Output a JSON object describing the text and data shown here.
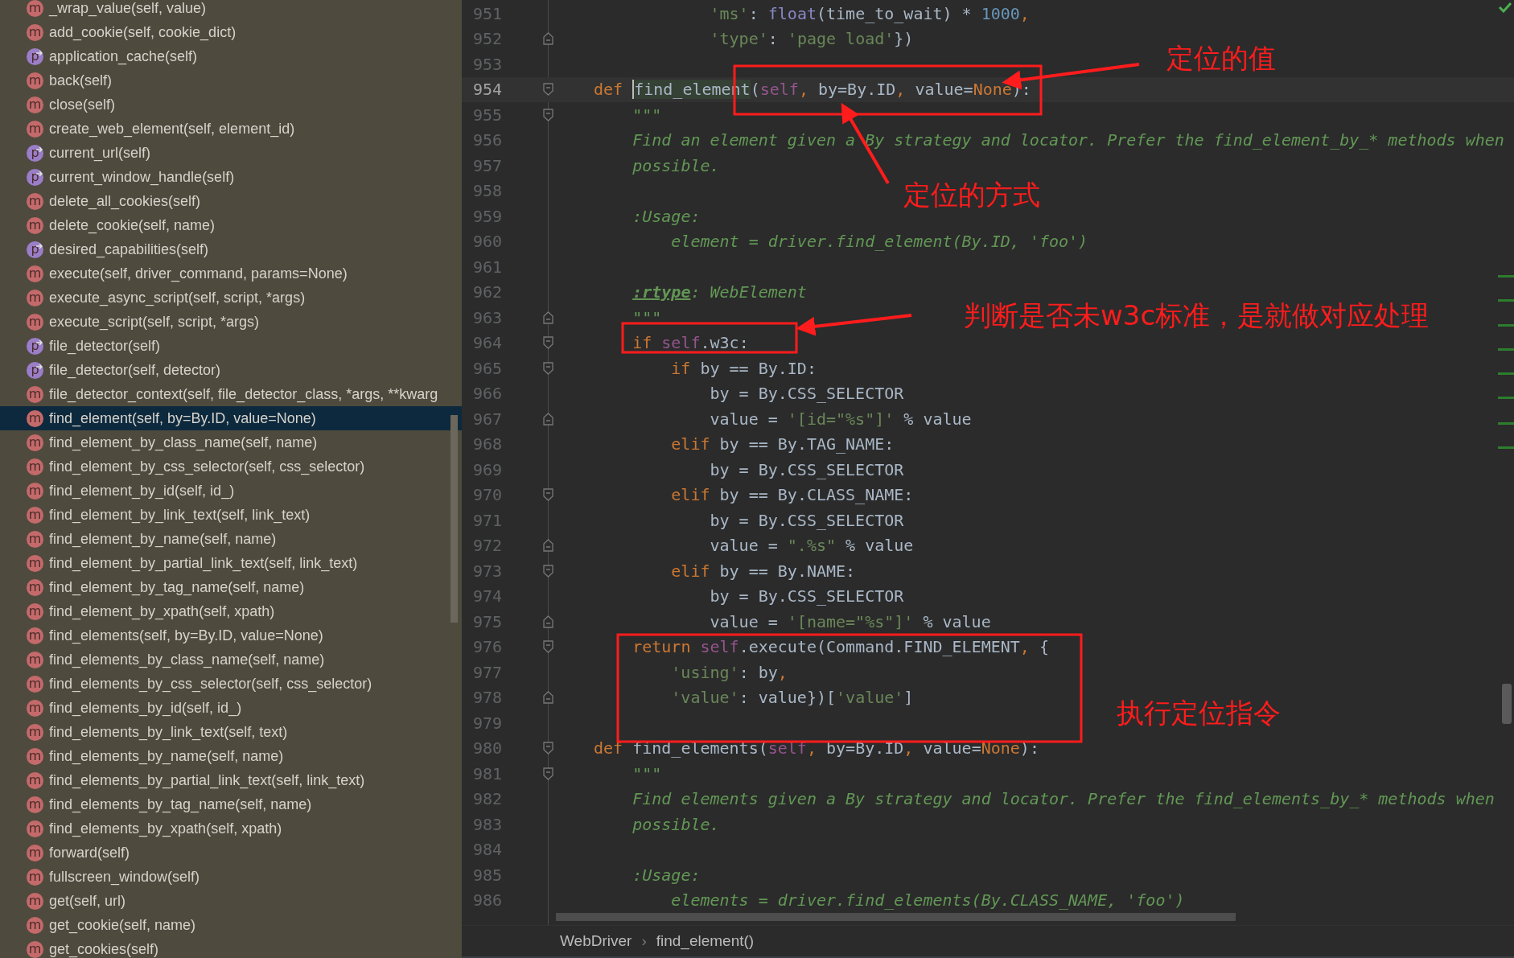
{
  "structure": {
    "items": [
      {
        "kind": "method",
        "badge": "m",
        "label": "_wrap_value(self, value)",
        "selected": false
      },
      {
        "kind": "method",
        "badge": "m",
        "label": "add_cookie(self, cookie_dict)",
        "selected": false
      },
      {
        "kind": "property",
        "badge": "p",
        "label": "application_cache(self)",
        "selected": false
      },
      {
        "kind": "method",
        "badge": "m",
        "label": "back(self)",
        "selected": false
      },
      {
        "kind": "method",
        "badge": "m",
        "label": "close(self)",
        "selected": false
      },
      {
        "kind": "method",
        "badge": "m",
        "label": "create_web_element(self, element_id)",
        "selected": false
      },
      {
        "kind": "property",
        "badge": "p",
        "label": "current_url(self)",
        "selected": false
      },
      {
        "kind": "property",
        "badge": "p",
        "label": "current_window_handle(self)",
        "selected": false
      },
      {
        "kind": "method",
        "badge": "m",
        "label": "delete_all_cookies(self)",
        "selected": false
      },
      {
        "kind": "method",
        "badge": "m",
        "label": "delete_cookie(self, name)",
        "selected": false
      },
      {
        "kind": "property",
        "badge": "p",
        "label": "desired_capabilities(self)",
        "selected": false
      },
      {
        "kind": "method",
        "badge": "m",
        "label": "execute(self, driver_command, params=None)",
        "selected": false
      },
      {
        "kind": "method",
        "badge": "m",
        "label": "execute_async_script(self, script, *args)",
        "selected": false
      },
      {
        "kind": "method",
        "badge": "m",
        "label": "execute_script(self, script, *args)",
        "selected": false
      },
      {
        "kind": "property",
        "badge": "p",
        "label": "file_detector(self)",
        "selected": false
      },
      {
        "kind": "property",
        "badge": "p",
        "label": "file_detector(self, detector)",
        "selected": false
      },
      {
        "kind": "method",
        "badge": "m",
        "label": "file_detector_context(self, file_detector_class, *args, **kwarg",
        "selected": false
      },
      {
        "kind": "method",
        "badge": "m",
        "label": "find_element(self, by=By.ID, value=None)",
        "selected": true
      },
      {
        "kind": "method",
        "badge": "m",
        "label": "find_element_by_class_name(self, name)",
        "selected": false
      },
      {
        "kind": "method",
        "badge": "m",
        "label": "find_element_by_css_selector(self, css_selector)",
        "selected": false
      },
      {
        "kind": "method",
        "badge": "m",
        "label": "find_element_by_id(self, id_)",
        "selected": false
      },
      {
        "kind": "method",
        "badge": "m",
        "label": "find_element_by_link_text(self, link_text)",
        "selected": false
      },
      {
        "kind": "method",
        "badge": "m",
        "label": "find_element_by_name(self, name)",
        "selected": false
      },
      {
        "kind": "method",
        "badge": "m",
        "label": "find_element_by_partial_link_text(self, link_text)",
        "selected": false
      },
      {
        "kind": "method",
        "badge": "m",
        "label": "find_element_by_tag_name(self, name)",
        "selected": false
      },
      {
        "kind": "method",
        "badge": "m",
        "label": "find_element_by_xpath(self, xpath)",
        "selected": false
      },
      {
        "kind": "method",
        "badge": "m",
        "label": "find_elements(self, by=By.ID, value=None)",
        "selected": false
      },
      {
        "kind": "method",
        "badge": "m",
        "label": "find_elements_by_class_name(self, name)",
        "selected": false
      },
      {
        "kind": "method",
        "badge": "m",
        "label": "find_elements_by_css_selector(self, css_selector)",
        "selected": false
      },
      {
        "kind": "method",
        "badge": "m",
        "label": "find_elements_by_id(self, id_)",
        "selected": false
      },
      {
        "kind": "method",
        "badge": "m",
        "label": "find_elements_by_link_text(self, text)",
        "selected": false
      },
      {
        "kind": "method",
        "badge": "m",
        "label": "find_elements_by_name(self, name)",
        "selected": false
      },
      {
        "kind": "method",
        "badge": "m",
        "label": "find_elements_by_partial_link_text(self, link_text)",
        "selected": false
      },
      {
        "kind": "method",
        "badge": "m",
        "label": "find_elements_by_tag_name(self, name)",
        "selected": false
      },
      {
        "kind": "method",
        "badge": "m",
        "label": "find_elements_by_xpath(self, xpath)",
        "selected": false
      },
      {
        "kind": "method",
        "badge": "m",
        "label": "forward(self)",
        "selected": false
      },
      {
        "kind": "method",
        "badge": "m",
        "label": "fullscreen_window(self)",
        "selected": false
      },
      {
        "kind": "method",
        "badge": "m",
        "label": "get(self, url)",
        "selected": false
      },
      {
        "kind": "method",
        "badge": "m",
        "label": "get_cookie(self, name)",
        "selected": false
      },
      {
        "kind": "method",
        "badge": "m",
        "label": "get_cookies(self)",
        "selected": false
      }
    ]
  },
  "editor": {
    "lines": [
      {
        "number": "951",
        "current": false,
        "tokens": [
          {
            "kind": "str",
            "text": "            'ms'"
          },
          {
            "kind": "p",
            "text": ": "
          },
          {
            "kind": "bi",
            "text": "float"
          },
          {
            "kind": "p",
            "text": "(time_to_wait) * "
          },
          {
            "kind": "num",
            "text": "1000"
          },
          {
            "kind": "kw",
            "text": ","
          }
        ]
      },
      {
        "number": "952",
        "current": false,
        "fold": {
          "kind": "close"
        },
        "tokens": [
          {
            "kind": "str",
            "text": "            'type'"
          },
          {
            "kind": "p",
            "text": ": "
          },
          {
            "kind": "str",
            "text": "'page load'"
          },
          {
            "kind": "p",
            "text": "})"
          }
        ]
      },
      {
        "number": "953",
        "current": false
      },
      {
        "number": "954",
        "current": true,
        "fold": {
          "kind": "open"
        },
        "tokens": [
          {
            "kind": "kw",
            "text": "def "
          },
          {
            "kind": "hl",
            "text": "find_element"
          },
          {
            "kind": "p",
            "text": "("
          },
          {
            "kind": "self",
            "text": "self"
          },
          {
            "kind": "kw",
            "text": ", "
          },
          {
            "kind": "p",
            "text": "by=By.ID"
          },
          {
            "kind": "kw",
            "text": ", "
          },
          {
            "kind": "p",
            "text": "value="
          },
          {
            "kind": "kw",
            "text": "None"
          },
          {
            "kind": "p",
            "text": "):"
          }
        ]
      },
      {
        "number": "955",
        "current": false,
        "fold": {
          "kind": "open"
        },
        "tokens": [
          {
            "kind": "doc",
            "text": "    \"\"\""
          }
        ]
      },
      {
        "number": "956",
        "current": false,
        "tokens": [
          {
            "kind": "doc",
            "text": "    Find an element given a By strategy and locator. Prefer the find_element_by_* methods when"
          }
        ]
      },
      {
        "number": "957",
        "current": false,
        "tokens": [
          {
            "kind": "doc",
            "text": "    possible."
          }
        ]
      },
      {
        "number": "958",
        "current": false
      },
      {
        "number": "959",
        "current": false,
        "tokens": [
          {
            "kind": "doc",
            "text": "    :Usage:"
          }
        ]
      },
      {
        "number": "960",
        "current": false,
        "tokens": [
          {
            "kind": "doc",
            "text": "        element = driver.find_element(By.ID, 'foo')"
          }
        ]
      },
      {
        "number": "961",
        "current": false
      },
      {
        "number": "962",
        "current": false,
        "tokens": [
          {
            "kind": "tag",
            "text": "    :rtype"
          },
          {
            "kind": "doc",
            "text": ": WebElement"
          }
        ]
      },
      {
        "number": "963",
        "current": false,
        "fold": {
          "kind": "close"
        },
        "tokens": [
          {
            "kind": "doc",
            "text": "    \"\"\""
          }
        ]
      },
      {
        "number": "964",
        "current": false,
        "fold": {
          "kind": "open"
        },
        "tokens": [
          {
            "kind": "kw",
            "text": "    if "
          },
          {
            "kind": "self",
            "text": "self"
          },
          {
            "kind": "p",
            "text": ".w3c:"
          }
        ]
      },
      {
        "number": "965",
        "current": false,
        "fold": {
          "kind": "open"
        },
        "tokens": [
          {
            "kind": "kw",
            "text": "        if "
          },
          {
            "kind": "p",
            "text": "by == By.ID:"
          }
        ]
      },
      {
        "number": "966",
        "current": false,
        "tokens": [
          {
            "kind": "p",
            "text": "            by = By.CSS_SELECTOR"
          }
        ]
      },
      {
        "number": "967",
        "current": false,
        "fold": {
          "kind": "close"
        },
        "tokens": [
          {
            "kind": "p",
            "text": "            value = "
          },
          {
            "kind": "str",
            "text": "'[id=\"%s\"]'"
          },
          {
            "kind": "p",
            "text": " % value"
          }
        ]
      },
      {
        "number": "968",
        "current": false,
        "tokens": [
          {
            "kind": "kw",
            "text": "        elif "
          },
          {
            "kind": "p",
            "text": "by == By.TAG_NAME:"
          }
        ]
      },
      {
        "number": "969",
        "current": false,
        "tokens": [
          {
            "kind": "p",
            "text": "            by = By.CSS_SELECTOR"
          }
        ]
      },
      {
        "number": "970",
        "current": false,
        "fold": {
          "kind": "open"
        },
        "tokens": [
          {
            "kind": "kw",
            "text": "        elif "
          },
          {
            "kind": "p",
            "text": "by == By.CLASS_NAME:"
          }
        ]
      },
      {
        "number": "971",
        "current": false,
        "tokens": [
          {
            "kind": "p",
            "text": "            by = By.CSS_SELECTOR"
          }
        ]
      },
      {
        "number": "972",
        "current": false,
        "fold": {
          "kind": "close"
        },
        "tokens": [
          {
            "kind": "p",
            "text": "            value = "
          },
          {
            "kind": "str",
            "text": "\".%s\""
          },
          {
            "kind": "p",
            "text": " % value"
          }
        ]
      },
      {
        "number": "973",
        "current": false,
        "fold": {
          "kind": "open"
        },
        "tokens": [
          {
            "kind": "kw",
            "text": "        elif "
          },
          {
            "kind": "p",
            "text": "by == By.NAME:"
          }
        ]
      },
      {
        "number": "974",
        "current": false,
        "tokens": [
          {
            "kind": "p",
            "text": "            by = By.CSS_SELECTOR"
          }
        ]
      },
      {
        "number": "975",
        "current": false,
        "fold": {
          "kind": "close"
        },
        "tokens": [
          {
            "kind": "p",
            "text": "            value = "
          },
          {
            "kind": "str",
            "text": "'[name=\"%s\"]'"
          },
          {
            "kind": "p",
            "text": " % value"
          }
        ]
      },
      {
        "number": "976",
        "current": false,
        "fold": {
          "kind": "open"
        },
        "tokens": [
          {
            "kind": "kw",
            "text": "    return "
          },
          {
            "kind": "self",
            "text": "self"
          },
          {
            "kind": "p",
            "text": ".execute(Command.FIND_ELEMENT"
          },
          {
            "kind": "kw",
            "text": ", "
          },
          {
            "kind": "p",
            "text": "{"
          }
        ]
      },
      {
        "number": "977",
        "current": false,
        "tokens": [
          {
            "kind": "str",
            "text": "        'using'"
          },
          {
            "kind": "p",
            "text": ": by"
          },
          {
            "kind": "kw",
            "text": ","
          }
        ]
      },
      {
        "number": "978",
        "current": false,
        "fold": {
          "kind": "close"
        },
        "tokens": [
          {
            "kind": "str",
            "text": "        'value'"
          },
          {
            "kind": "p",
            "text": ": value})["
          },
          {
            "kind": "str",
            "text": "'value'"
          },
          {
            "kind": "p",
            "text": "]"
          }
        ]
      },
      {
        "number": "979",
        "current": false
      },
      {
        "number": "980",
        "current": false,
        "fold": {
          "kind": "open"
        },
        "tokens": [
          {
            "kind": "kw",
            "text": "def "
          },
          {
            "kind": "p",
            "text": "find_elements("
          },
          {
            "kind": "self",
            "text": "self"
          },
          {
            "kind": "kw",
            "text": ", "
          },
          {
            "kind": "p",
            "text": "by=By.ID"
          },
          {
            "kind": "kw",
            "text": ", "
          },
          {
            "kind": "p",
            "text": "value="
          },
          {
            "kind": "kw",
            "text": "None"
          },
          {
            "kind": "p",
            "text": "):"
          }
        ]
      },
      {
        "number": "981",
        "current": false,
        "fold": {
          "kind": "open"
        },
        "tokens": [
          {
            "kind": "doc",
            "text": "    \"\"\""
          }
        ]
      },
      {
        "number": "982",
        "current": false,
        "tokens": [
          {
            "kind": "doc",
            "text": "    Find elements given a By strategy and locator. Prefer the find_elements_by_* methods when"
          }
        ]
      },
      {
        "number": "983",
        "current": false,
        "tokens": [
          {
            "kind": "doc",
            "text": "    possible."
          }
        ]
      },
      {
        "number": "984",
        "current": false
      },
      {
        "number": "985",
        "current": false,
        "tokens": [
          {
            "kind": "doc",
            "text": "    :Usage:"
          }
        ]
      },
      {
        "number": "986",
        "current": false,
        "tokens": [
          {
            "kind": "doc",
            "text": "        elements = driver.find_elements(By.CLASS_NAME, 'foo')"
          }
        ]
      }
    ]
  },
  "annotations": [
    {
      "text": "定位的值"
    },
    {
      "text": "定位的方式"
    },
    {
      "text": "判断是否未w3c标准，是就做对应处理"
    },
    {
      "text": "执行定位指令"
    }
  ],
  "breadcrumb": {
    "items": [
      "WebDriver",
      "find_element()"
    ],
    "separator": "›"
  }
}
